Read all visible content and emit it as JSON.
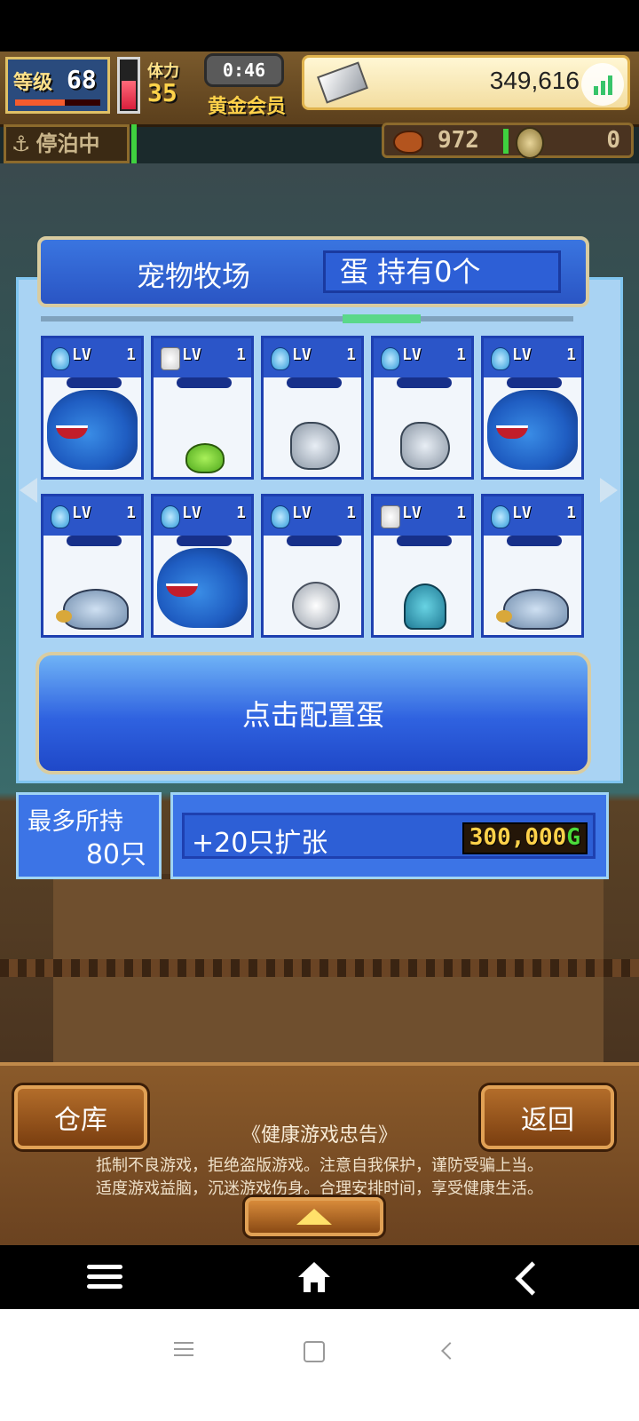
{
  "hud": {
    "level_label": "等级",
    "level_value": "68",
    "stamina_label": "体力",
    "stamina_value": "35",
    "timer": "0:46",
    "membership": "黄金会员",
    "money": "349,616",
    "anchor_status": "停泊中",
    "food_count": "972",
    "coin_count": "0"
  },
  "ranch": {
    "title": "宠物牧场",
    "egg_status": "蛋 持有0个",
    "pets": [
      {
        "lv_label": "LV",
        "level": "1",
        "icon": "water-drop-icon",
        "pet": "blue-sea-monster"
      },
      {
        "lv_label": "LV",
        "level": "1",
        "icon": "white-stone-icon",
        "pet": "green-slime"
      },
      {
        "lv_label": "LV",
        "level": "1",
        "icon": "water-drop-icon",
        "pet": "silver-fish"
      },
      {
        "lv_label": "LV",
        "level": "1",
        "icon": "water-drop-icon",
        "pet": "silver-fish"
      },
      {
        "lv_label": "LV",
        "level": "1",
        "icon": "water-drop-icon",
        "pet": "blue-sea-monster"
      },
      {
        "lv_label": "LV",
        "level": "1",
        "icon": "water-drop-icon",
        "pet": "turtle"
      },
      {
        "lv_label": "LV",
        "level": "1",
        "icon": "water-drop-icon",
        "pet": "blue-sea-monster"
      },
      {
        "lv_label": "LV",
        "level": "1",
        "icon": "water-drop-icon",
        "pet": "spiky-ball"
      },
      {
        "lv_label": "LV",
        "level": "1",
        "icon": "white-stone-icon",
        "pet": "sea-snake"
      },
      {
        "lv_label": "LV",
        "level": "1",
        "icon": "water-drop-icon",
        "pet": "turtle"
      }
    ],
    "configure_egg": "点击配置蛋",
    "capacity_label": "最多所持",
    "capacity_value": "80只",
    "expand_label": "+20只扩张",
    "expand_price": "300,000",
    "currency": "G"
  },
  "bottom": {
    "warehouse": "仓库",
    "back": "返回",
    "notice_title": "《健康游戏忠告》",
    "notice_line1": "抵制不良游戏，拒绝盗版游戏。注意自我保护，谨防受骗上当。",
    "notice_line2": "适度游戏益脑，沉迷游戏伤身。合理安排时间，享受健康生活。"
  },
  "colors": {
    "panel_blue": "#2f62e0",
    "gold_border": "#d9cca0",
    "wood": "#8a5a2a"
  }
}
